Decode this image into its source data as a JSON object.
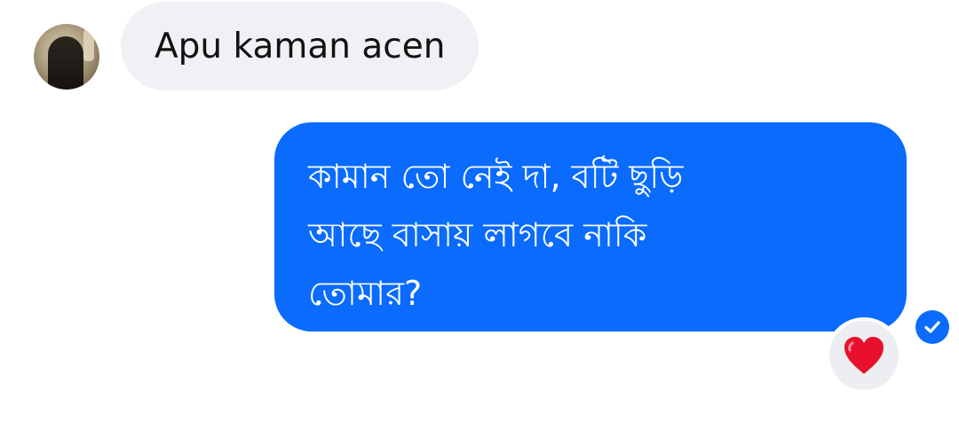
{
  "incoming_message": {
    "text": "Apu kaman acen",
    "avatar_icon": "contact-avatar"
  },
  "outgoing_message": {
    "lines": [
      "কামান তো নেই দা, বটি ছুড়ি",
      "আছে বাসায় লাগবে নাকি",
      "তোমার?"
    ]
  },
  "reaction": {
    "icon": "heart-icon",
    "color": "#e8112d"
  },
  "status": {
    "icon": "check-circle-icon",
    "state": "sent"
  },
  "colors": {
    "outgoing_bubble": "#0a6bfd",
    "incoming_bubble": "#f0f0f5",
    "status_blue": "#0a6bfd"
  }
}
